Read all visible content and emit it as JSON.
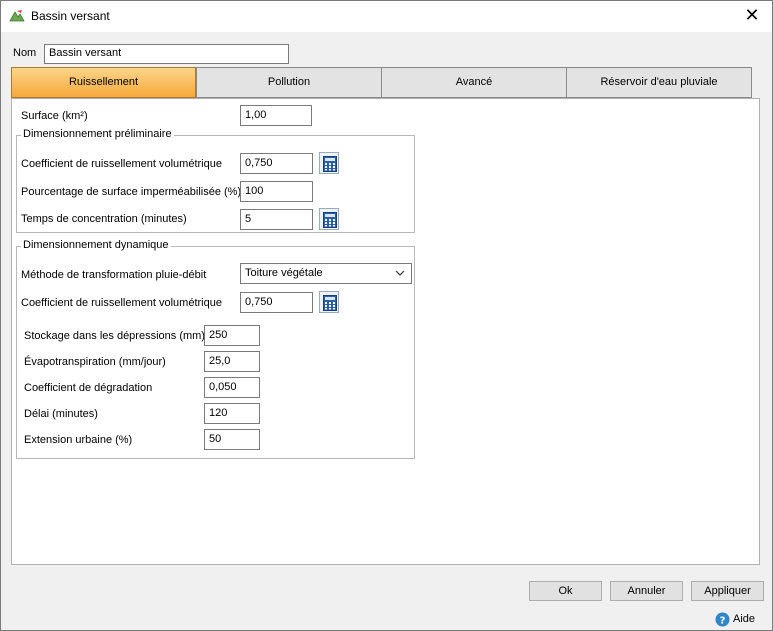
{
  "window": {
    "title": "Bassin versant",
    "close_glyph": "✕"
  },
  "name_field": {
    "label": "Nom",
    "value": "Bassin versant"
  },
  "tabs": [
    {
      "label": "Ruissellement",
      "active": true
    },
    {
      "label": "Pollution",
      "active": false
    },
    {
      "label": "Avancé",
      "active": false
    },
    {
      "label": "Réservoir d'eau pluviale",
      "active": false
    }
  ],
  "surface": {
    "label": "Surface (km²)",
    "value": "1,00"
  },
  "prelim": {
    "legend": "Dimensionnement préliminaire",
    "runoff_coef": {
      "label": "Coefficient de ruissellement volumétrique",
      "value": "0,750"
    },
    "impervious": {
      "label": "Pourcentage de surface imperméabilisée (%)",
      "value": "100"
    },
    "concentration": {
      "label": "Temps de concentration (minutes)",
      "value": "5"
    }
  },
  "dynamic": {
    "legend": "Dimensionnement dynamique",
    "method": {
      "label": "Méthode de transformation pluie-débit",
      "value": "Toiture végétale"
    },
    "runoff_coef": {
      "label": "Coefficient de ruissellement volumétrique",
      "value": "0,750"
    },
    "depression": {
      "label": "Stockage dans les dépressions (mm)",
      "value": "250"
    },
    "evapo": {
      "label": "Évapotranspiration (mm/jour)",
      "value": "25,0"
    },
    "degradation": {
      "label": "Coefficient de dégradation",
      "value": "0,050"
    },
    "delay": {
      "label": "Délai (minutes)",
      "value": "120"
    },
    "urban": {
      "label": "Extension urbaine (%)",
      "value": "50"
    }
  },
  "buttons": {
    "ok": "Ok",
    "cancel": "Annuler",
    "apply": "Appliquer"
  },
  "help": {
    "label": "Aide"
  },
  "colors": {
    "tab_active": "#f5a93a",
    "calc_icon": "#2a5ea8",
    "help_icon": "#2e86c9"
  }
}
